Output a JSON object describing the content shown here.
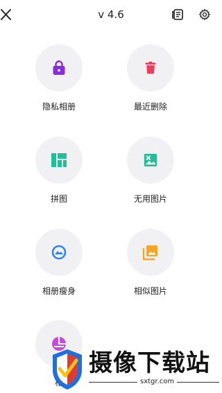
{
  "header": {
    "version": "v 4.6",
    "close_icon": "close-icon",
    "book_icon": "book-icon",
    "settings_icon": "gear-icon"
  },
  "colors": {
    "purple": "#8a2be2",
    "red": "#f03c5a",
    "teal": "#1fbf98",
    "blue": "#2f84f0",
    "orange": "#f5a623",
    "magenta": "#c64ae0",
    "circle_bg": "#f1f1f4"
  },
  "tools": [
    {
      "label": "隐私相册",
      "icon": "lock-icon"
    },
    {
      "label": "最近删除",
      "icon": "trash-icon"
    },
    {
      "label": "拼图",
      "icon": "collage-icon"
    },
    {
      "label": "无用图片",
      "icon": "broken-image-icon"
    },
    {
      "label": "相册瘦身",
      "icon": "slim-icon"
    },
    {
      "label": "相似图片",
      "icon": "similar-images-icon"
    },
    {
      "label": "相",
      "icon": "pie-chart-icon"
    }
  ],
  "watermark": {
    "brand": "摄像下载站",
    "url": "sxtgr.com"
  }
}
